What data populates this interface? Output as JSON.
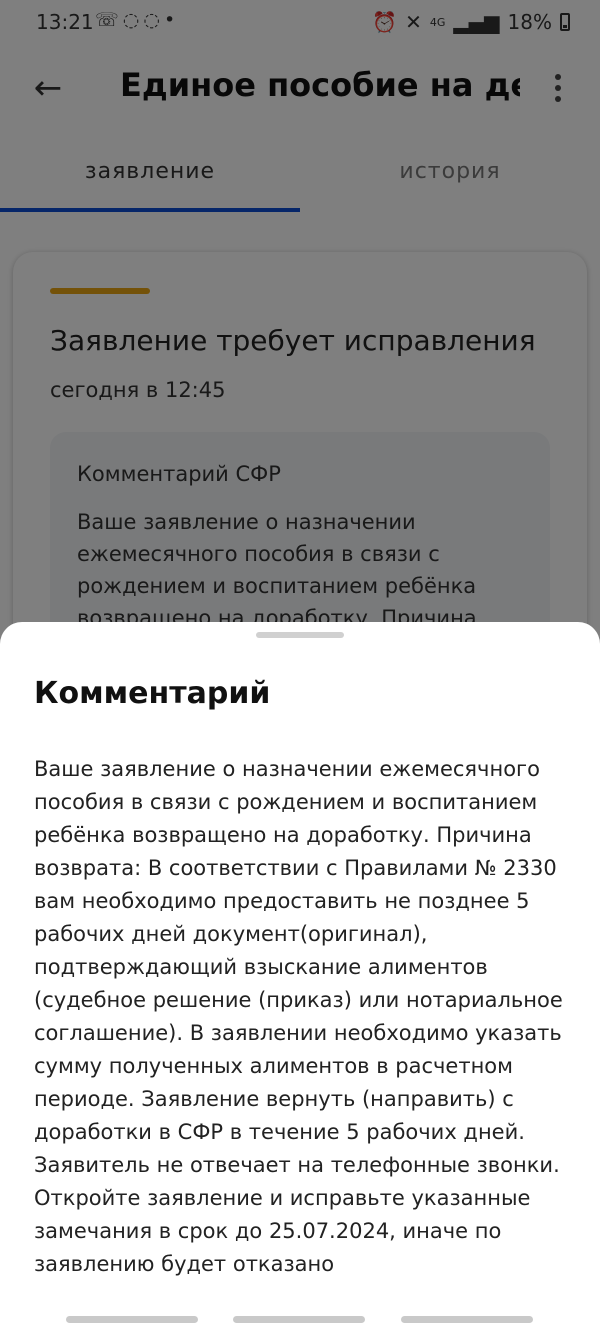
{
  "status_bar": {
    "time": "13:21",
    "notification_icons": [
      "call-icon",
      "whatsapp-icon",
      "viber-icon",
      "dot"
    ],
    "network_label": "4G",
    "battery_percent": "18%"
  },
  "app_bar": {
    "title": "Единое пособие на дете...",
    "back_icon": "arrow-left-icon",
    "more_icon": "more-vertical-icon"
  },
  "tabs": [
    {
      "label": "заявление",
      "selected": true
    },
    {
      "label": "история",
      "selected": false
    }
  ],
  "status_card": {
    "accent_color": "#e8a512",
    "title": "Заявление требует исправления",
    "date": "сегодня в 12:45",
    "comment_title": "Комментарий СФР",
    "comment_preview": "Ваше заявление о назначении ежемесячного пособия в связи с рождением и воспитанием ребёнка возвращено на доработку. Причина"
  },
  "bottom_sheet": {
    "title": "Комментарий",
    "text": "Ваше заявление о назначении ежемесячного пособия в связи с рождением и воспитанием ребёнка возвращено на доработку. Причина возврата: В соответствии с Правилами № 2330 вам необходимо предоставить не позднее 5 рабочих дней документ(оригинал), подтверждающий взыскание алиментов (судебное решение (приказ) или нотариальное соглашение). В заявлении необходимо указать сумму полученных алиментов в расчетном периоде. Заявление вернуть (направить) с доработки в СФР в течение 5 рабочих дней. Заявитель не отвечает на телефонные звонки. Откройте заявление и исправьте указанные замечания в срок до 25.07.2024, иначе по заявлению будет отказано"
  },
  "colors": {
    "accent_blue": "#0d4cd3",
    "warning_yellow": "#e8a512"
  }
}
